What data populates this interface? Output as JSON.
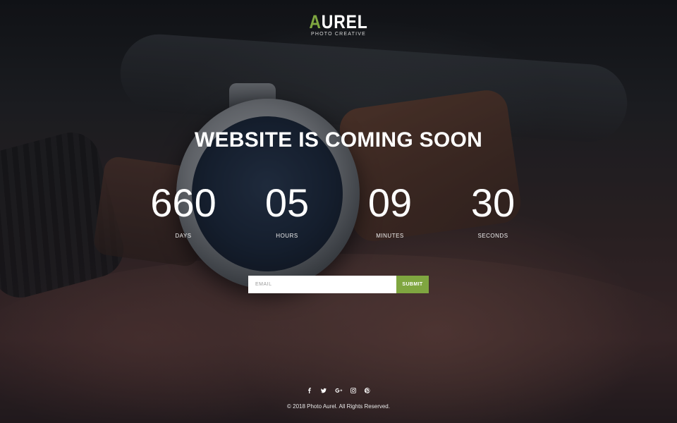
{
  "brand": {
    "logo_first_letter": "A",
    "logo_rest": "UREL",
    "tagline": "PHOTO CREATIVE",
    "accent_color": "#7fa640"
  },
  "hero": {
    "headline": "WEBSITE IS COMING SOON"
  },
  "countdown": [
    {
      "value": "660",
      "label": "DAYS"
    },
    {
      "value": "05",
      "label": "HOURS"
    },
    {
      "value": "09",
      "label": "MINUTES"
    },
    {
      "value": "30",
      "label": "SECONDS"
    }
  ],
  "subscribe": {
    "email_placeholder": "EMAIL",
    "email_value": "",
    "submit_label": "SUBMIT"
  },
  "social": [
    {
      "icon": "facebook-icon",
      "glyph": "f"
    },
    {
      "icon": "twitter-icon",
      "glyph": "t"
    },
    {
      "icon": "google-plus-icon",
      "glyph": "G+"
    },
    {
      "icon": "instagram-icon",
      "glyph": "ig"
    },
    {
      "icon": "pinterest-icon",
      "glyph": "p"
    }
  ],
  "footer": {
    "copyright": "© 2018 Photo Aurel. All Rights Reserved."
  }
}
